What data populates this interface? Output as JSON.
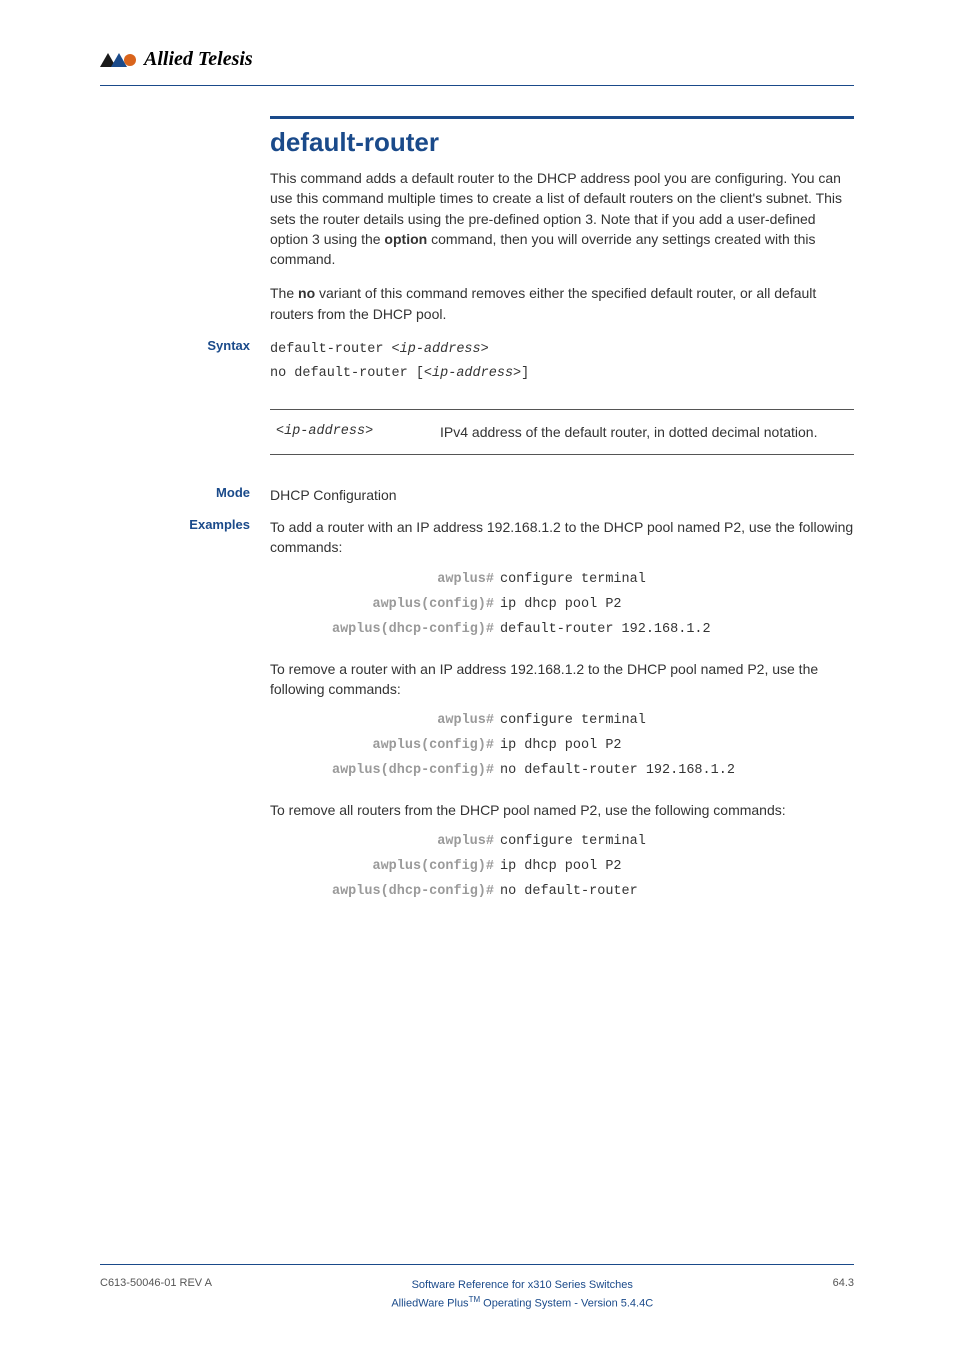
{
  "brand": {
    "logo_text": "Allied Telesis"
  },
  "title": "default-router",
  "intro_p1_a": "This command adds a default router to the DHCP address pool you are configuring. You can use this command multiple times to create a list of default routers on the client's subnet. This sets the router details using the pre-defined option 3. Note that if you add a user-defined option 3 using the ",
  "intro_p1_bold": "option",
  "intro_p1_b": " command, then you will override any settings created with this command.",
  "intro_p2_a": "The ",
  "intro_p2_bold": "no",
  "intro_p2_b": " variant of this command removes either the specified default router, or all default routers from the DHCP pool.",
  "labels": {
    "syntax": "Syntax",
    "mode": "Mode",
    "examples": "Examples"
  },
  "syntax": {
    "line1_a": "default-router <",
    "line1_i": "ip-address",
    "line1_b": ">",
    "line2_a": "no default-router [<",
    "line2_i": "ip-address",
    "line2_b": ">]"
  },
  "param": {
    "name": "<ip-address>",
    "desc": "IPv4 address of the default router, in dotted decimal notation."
  },
  "mode_text": "DHCP Configuration",
  "examples": {
    "ex1_text": "To add a router with an IP address 192.168.1.2 to the DHCP pool named P2, use the following commands:",
    "ex2_text": "To remove a router with an IP address 192.168.1.2 to the DHCP pool named P2, use the following commands:",
    "ex3_text": "To remove all routers from the DHCP pool named P2, use the following commands:",
    "prompt1": "awplus#",
    "prompt2": "awplus(config)#",
    "prompt3": "awplus(dhcp-config)#",
    "cmd1": "configure terminal",
    "cmd2": "ip dhcp pool P2",
    "cmd3a": "default-router 192.168.1.2",
    "cmd3b": "no default-router 192.168.1.2",
    "cmd3c": "no default-router"
  },
  "footer": {
    "left": "C613-50046-01 REV A",
    "center1": "Software Reference for x310 Series Switches",
    "center2_a": "AlliedWare Plus",
    "center2_tm": "TM",
    "center2_b": " Operating System - Version 5.4.4C",
    "right": "64.3"
  }
}
